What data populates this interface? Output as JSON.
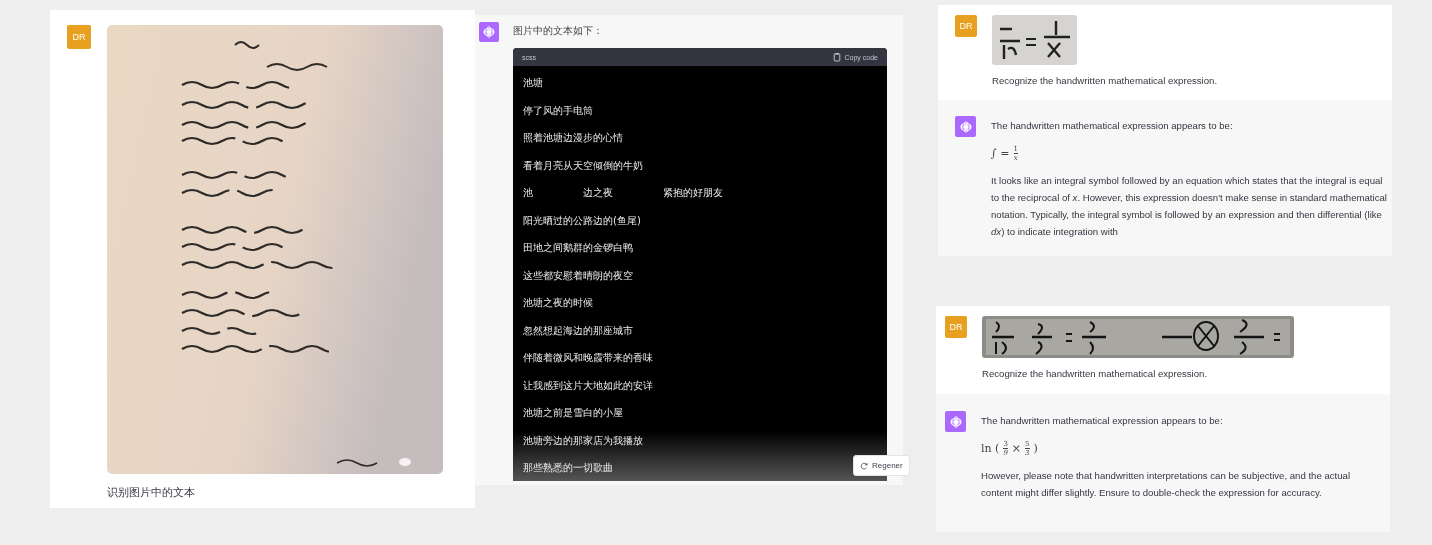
{
  "panels": [
    {
      "kind": "chat_image_text",
      "messages": [
        {
          "kind": "user",
          "avatar": "DR",
          "text": "识别图片中的文本"
        }
      ]
    },
    {
      "kind": "chat_code",
      "messages": [
        {
          "kind": "assistant",
          "text": "图片中的文本如下：",
          "code": {
            "language": "scss",
            "copy_label": "Copy code",
            "lines": [
              "池塘",
              "停了风的手电筒",
              "照着池塘边漫步的心情",
              "看着月亮从天空倾倒的牛奶",
              "池　　　　　边之夜　　　　　紧抱的好朋友",
              "阳光晒过的公路边的(鱼尾)",
              "田地之间鹅群的金锣白鸭",
              "这些都安慰着晴朗的夜空",
              "池塘之夜的时候",
              "忽然想起海边的那座城市",
              "伴随着微风和晚霞带来的香味",
              "让我感到这片大地如此的安详",
              "池塘之前是雪白的小屋",
              "池塘旁边的那家店为我播放",
              "那些熟悉的一切歌曲"
            ]
          }
        }
      ],
      "regenerate_label": "Regener"
    },
    {
      "kind": "chat_math",
      "messages": [
        {
          "kind": "user",
          "avatar": "DR",
          "text": "Recognize the handwritten mathematical expression."
        },
        {
          "kind": "assistant",
          "text": "The handwritten mathematical expression appears to be:",
          "formula": [
            {
              "kind": "text",
              "text": "∫ ="
            },
            {
              "kind": "frac",
              "num": "1",
              "den": "x"
            }
          ],
          "paragraph": "It looks like an integral symbol followed by an equation which states that the integral is equal to the reciprocal of *x*. However, this expression doesn't make sense in standard mathematical notation. Typically, the integral symbol is followed by an expression and then differential (like *dx*) to indicate integration with"
        }
      ]
    },
    {
      "kind": "chat_math",
      "messages": [
        {
          "kind": "user",
          "avatar": "DR",
          "text": "Recognize the handwritten mathematical expression."
        },
        {
          "kind": "assistant",
          "text": "The handwritten mathematical expression appears to be:",
          "formula": [
            {
              "kind": "text",
              "text": "ln ("
            },
            {
              "kind": "frac",
              "num": "3",
              "den": "9"
            },
            {
              "kind": "text",
              "text": "×"
            },
            {
              "kind": "frac",
              "num": "5",
              "den": "3"
            },
            {
              "kind": "text",
              "text": ")"
            }
          ],
          "paragraph": "However, please note that handwritten interpretations can be subjective, and the actual content might differ slightly. Ensure to double-check the expression for accuracy."
        }
      ]
    }
  ]
}
